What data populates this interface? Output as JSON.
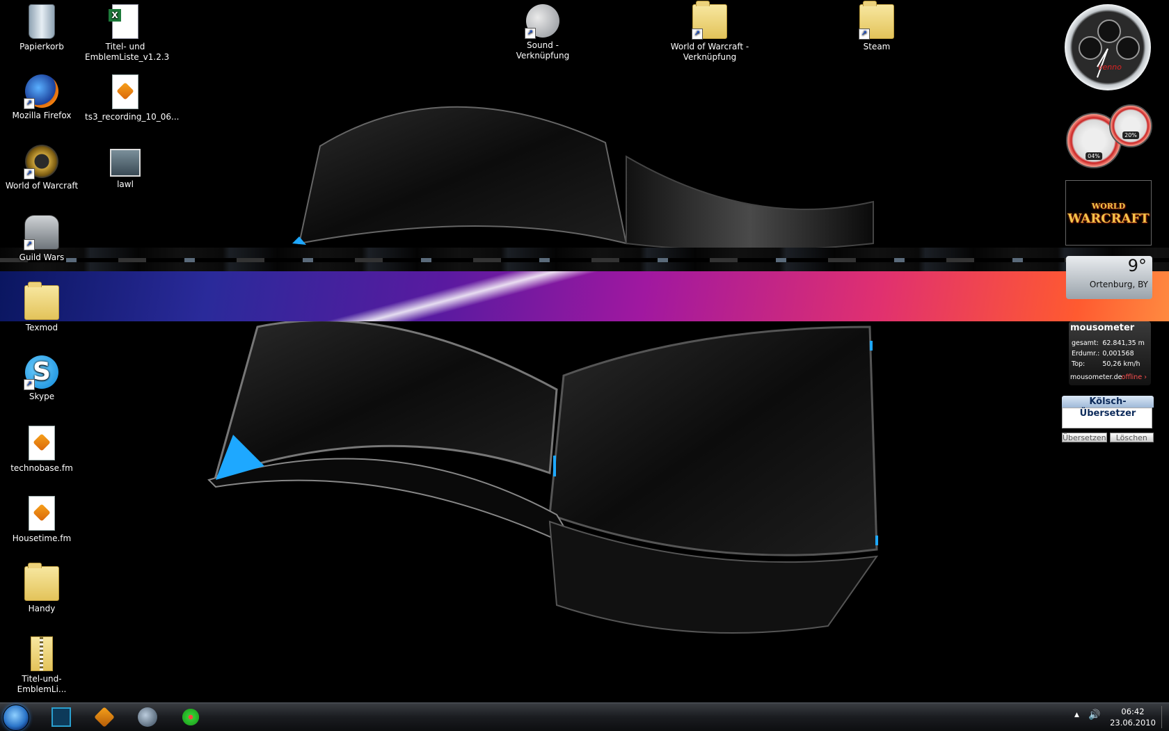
{
  "desktop_icons": [
    {
      "label": "Papierkorb",
      "icon": "recycle-bin-icon"
    },
    {
      "label": "Titel- und\nEmblemListe_v1.2.3",
      "icon": "excel-file-icon"
    },
    {
      "label": "Sound - Verknüpfung",
      "icon": "speaker-icon"
    },
    {
      "label": "World of Warcraft -\nVerknüpfung",
      "icon": "folder-icon"
    },
    {
      "label": "Steam",
      "icon": "folder-icon"
    },
    {
      "label": "Mozilla Firefox",
      "icon": "firefox-icon"
    },
    {
      "label": "ts3_recording_10_06...",
      "icon": "playlist-file-icon"
    },
    {
      "label": "World of Warcraft",
      "icon": "wow-icon"
    },
    {
      "label": "lawl",
      "icon": "image-file-icon"
    },
    {
      "label": "Guild Wars",
      "icon": "guild-wars-icon"
    },
    {
      "label": "Texmod",
      "icon": "folder-icon"
    },
    {
      "label": "Skype",
      "icon": "skype-icon"
    },
    {
      "label": "technobase.fm",
      "icon": "playlist-file-icon"
    },
    {
      "label": "Housetime.fm",
      "icon": "playlist-file-icon"
    },
    {
      "label": "Handy",
      "icon": "folder-icon"
    },
    {
      "label": "Titel-und-EmblemLi...",
      "icon": "zip-folder-icon"
    }
  ],
  "clock": {
    "brand": "venno"
  },
  "cpu_meter": {
    "cpu": "04%",
    "ram": "20%"
  },
  "wow_gadget": {
    "line1": "WORLD",
    "line2": "WARCRAFT"
  },
  "weather": {
    "temp": "9°",
    "city": "Ortenburg, BY"
  },
  "mousometer": {
    "title": "mousometer",
    "rows": [
      {
        "label": "gesamt:",
        "value": "62.841,35 m"
      },
      {
        "label": "Erdumr.:",
        "value": "0,001568"
      },
      {
        "label": "Top:",
        "value": "50,26 km/h"
      }
    ],
    "site": "mousometer.de",
    "status": "offline ›"
  },
  "koelsch": {
    "title": "Kölsch-Übersetzer",
    "translate": "Übersetzen",
    "clear": "Löschen"
  },
  "taskbar": {
    "items": [
      {
        "icon": "start-orb-icon"
      },
      {
        "icon": "app-window-icon"
      },
      {
        "icon": "winamp-icon"
      },
      {
        "icon": "teamspeak-icon"
      },
      {
        "icon": "icq-flower-icon"
      }
    ],
    "tray": {
      "up_arrow": "▲",
      "volume": "🔊",
      "time": "06:42",
      "date": "23.06.2010"
    }
  },
  "colors": {
    "accent": "#2a74c8",
    "stripe_start": "#0a1660",
    "stripe_mid": "#a018a0",
    "stripe_end": "#ff8a40"
  }
}
